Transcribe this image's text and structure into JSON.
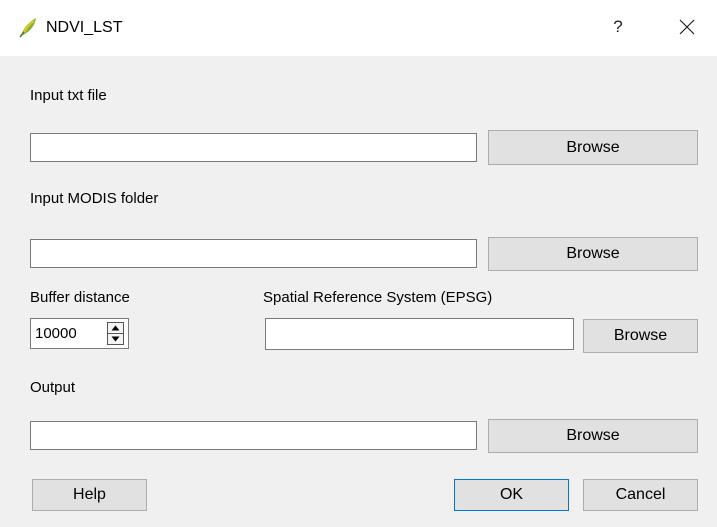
{
  "window": {
    "title": "NDVI_LST",
    "help_glyph": "?",
    "icon": "qgis-logo-icon"
  },
  "form": {
    "input_txt": {
      "label": "Input txt file",
      "value": "",
      "browse_label": "Browse"
    },
    "modis_folder": {
      "label": "Input MODIS folder",
      "value": "",
      "browse_label": "Browse"
    },
    "buffer_distance": {
      "label": "Buffer distance",
      "value": "10000"
    },
    "srs": {
      "label": "Spatial Reference System (EPSG)",
      "value": "",
      "browse_label": "Browse"
    },
    "output": {
      "label": "Output",
      "value": "",
      "browse_label": "Browse"
    }
  },
  "footer": {
    "help_label": "Help",
    "ok_label": "OK",
    "cancel_label": "Cancel"
  },
  "colors": {
    "client_background": "#f0f0f0",
    "button_face": "#e1e1e1",
    "default_button_border": "#0078d7",
    "logo_green": "#7cb342",
    "logo_yellow": "#f2c500"
  }
}
